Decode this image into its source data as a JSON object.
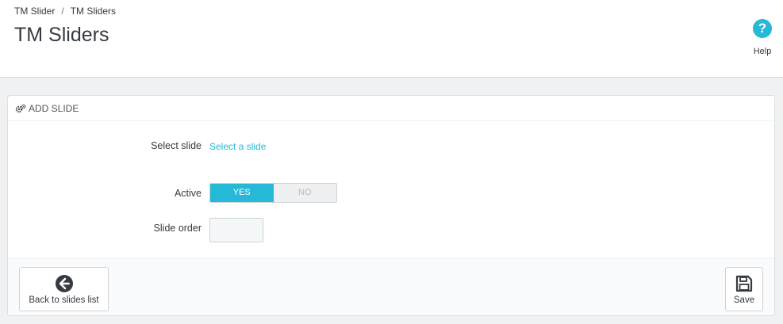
{
  "breadcrumb": {
    "items": [
      "TM Slider",
      "TM Sliders"
    ],
    "separator": "/"
  },
  "header": {
    "title": "TM Sliders",
    "help_label": "Help"
  },
  "panel": {
    "heading": "ADD SLIDE",
    "fields": {
      "select_slide_label": "Select slide",
      "select_slide_link": "Select a slide",
      "active_label": "Active",
      "active_yes": "YES",
      "active_no": "NO",
      "active_value": "YES",
      "slide_order_label": "Slide order",
      "slide_order_value": ""
    },
    "footer": {
      "back_label": "Back to slides list",
      "save_label": "Save"
    }
  },
  "colors": {
    "accent": "#25b9d7",
    "text": "#363a41",
    "background": "#eff1f2"
  },
  "icons": {
    "help": "question-circle-icon",
    "heading": "cogs-icon",
    "back": "arrow-circle-left-icon",
    "save": "floppy-disk-icon"
  }
}
